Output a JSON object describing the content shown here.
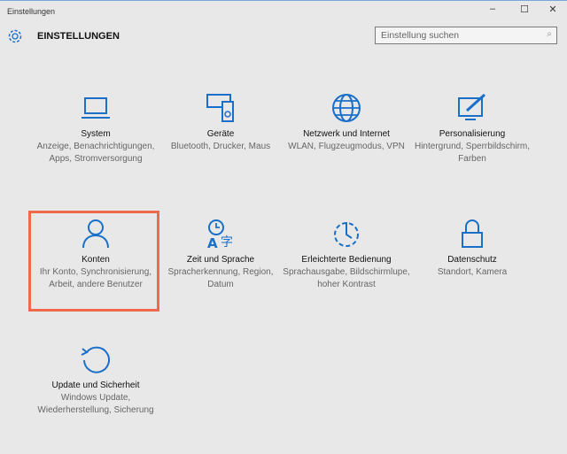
{
  "window": {
    "title": "Einstellungen",
    "minimize": "–",
    "maximize": "☐",
    "close": "✕"
  },
  "header": {
    "title": "EINSTELLUNGEN",
    "search_placeholder": "Einstellung suchen"
  },
  "accent": "#1a6fc9",
  "highlight": "#ef6a4a",
  "tiles": [
    {
      "name": "System",
      "desc": "Anzeige, Benachrichtigungen, Apps, Stromversorgung",
      "icon": "laptop-icon"
    },
    {
      "name": "Geräte",
      "desc": "Bluetooth, Drucker, Maus",
      "icon": "devices-icon"
    },
    {
      "name": "Netzwerk und Internet",
      "desc": "WLAN, Flugzeugmodus, VPN",
      "icon": "globe-icon"
    },
    {
      "name": "Personalisierung",
      "desc": "Hintergrund, Sperrbildschirm, Farben",
      "icon": "paint-icon"
    },
    {
      "name": "Konten",
      "desc": "Ihr Konto, Synchronisierung, Arbeit, andere Benutzer",
      "icon": "person-icon"
    },
    {
      "name": "Zeit und Sprache",
      "desc": "Spracherkennung, Region, Datum",
      "icon": "time-language-icon"
    },
    {
      "name": "Erleichterte Bedienung",
      "desc": "Sprachausgabe, Bildschirmlupe, hoher Kontrast",
      "icon": "ease-of-access-icon"
    },
    {
      "name": "Datenschutz",
      "desc": "Standort, Kamera",
      "icon": "lock-icon"
    },
    {
      "name": "Update und Sicherheit",
      "desc": "Windows Update, Wiederherstellung, Sicherung",
      "icon": "update-icon"
    }
  ]
}
